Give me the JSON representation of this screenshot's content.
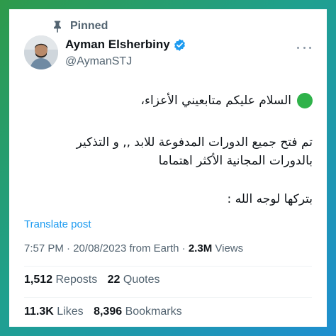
{
  "pinned_label": "Pinned",
  "author": {
    "display_name": "Ayman Elsherbiny",
    "handle": "@AymanSTJ",
    "verified_icon": "verified-badge-icon",
    "avatar_icon": "avatar"
  },
  "more_icon": "more-options-icon",
  "tweet": {
    "line1": "السلام عليكم متابعيني الأعزاء،",
    "line2": "تم فتح جميع الدورات المدفوعة للابد ,, و التذكير",
    "line3": "بالدورات المجانية الأكثر اهتماما",
    "line4": "بتركها لوجه الله :"
  },
  "translate_label": "Translate post",
  "meta": {
    "time": "7:57 PM",
    "date": "20/08/2023",
    "source": "from Earth",
    "separator": "·",
    "views_count": "2.3M",
    "views_label": "Views"
  },
  "stats": {
    "reposts_count": "1,512",
    "reposts_label": "Reposts",
    "quotes_count": "22",
    "quotes_label": "Quotes",
    "likes_count": "11.3K",
    "likes_label": "Likes",
    "bookmarks_count": "8,396",
    "bookmarks_label": "Bookmarks"
  },
  "colors": {
    "accent": "#1d9bf0",
    "verified": "#1d9bf0",
    "green_emoji": "#2fb24a",
    "muted_text": "#536471",
    "primary_text": "#0f1419"
  }
}
